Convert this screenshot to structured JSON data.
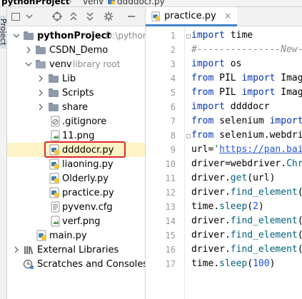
{
  "breadcrumb": {
    "project": "pythonProject",
    "sep": "›",
    "folder": "venv",
    "file": "ddddocr.py"
  },
  "toolwindow": {
    "side_label": "Project"
  },
  "project_header": {
    "buttons": [
      "square-icon",
      "chevron-down-icon",
      "crosshair-icon",
      "collapse-icon",
      "expand-icon",
      "gear-icon",
      "minus-icon"
    ]
  },
  "tree": {
    "root": {
      "label": "pythonProject",
      "hint": "D:\\python"
    },
    "items": [
      {
        "label": "CSDN_Demo",
        "icon": "folder-icon"
      },
      {
        "label": "venv",
        "hint": "library root",
        "icon": "folder-icon"
      },
      {
        "label": "Lib",
        "icon": "folder-icon"
      },
      {
        "label": "Scripts",
        "icon": "folder-icon"
      },
      {
        "label": "share",
        "icon": "folder-icon"
      },
      {
        "label": ".gitignore",
        "icon": "gitignore-icon"
      },
      {
        "label": "11.png",
        "icon": "image-file-icon"
      },
      {
        "label": "ddddocr.py",
        "icon": "python-file-icon"
      },
      {
        "label": "liaoning.py",
        "icon": "python-file-icon"
      },
      {
        "label": "Olderly.py",
        "icon": "python-file-icon"
      },
      {
        "label": "practice.py",
        "icon": "python-file-icon"
      },
      {
        "label": "pyvenv.cfg",
        "icon": "config-file-icon"
      },
      {
        "label": "verf.png",
        "icon": "image-file-icon"
      },
      {
        "label": "main.py",
        "icon": "python-file-icon"
      },
      {
        "label": "External Libraries",
        "icon": "libraries-icon"
      },
      {
        "label": "Scratches and Consoles",
        "icon": "scratches-icon"
      }
    ]
  },
  "editor": {
    "tab": {
      "label": "practice.py",
      "close": "×"
    },
    "line_numbers": [
      "1",
      "2",
      "3",
      "4",
      "5",
      "6",
      "7",
      "8",
      "9",
      "10",
      "11",
      "12",
      "13",
      "14",
      "15",
      "16",
      "17"
    ],
    "lines": [
      {
        "kw": "import",
        "rest": " time"
      },
      {
        "comment": "#---------------New-"
      },
      {
        "kw": "import",
        "rest": " os"
      },
      {
        "kw": "from",
        "rest": " PIL ",
        "kw2": "import",
        "rest2": " Imag"
      },
      {
        "kw": "from",
        "rest": " PIL ",
        "kw2": "import",
        "rest2": " Imag"
      },
      {
        "kw": "import",
        "rest": " ddddocr"
      },
      {
        "kw": "from",
        "rest": " selenium ",
        "kw2": "import"
      },
      {
        "kw": "from",
        "rest": " selenium.webdri"
      },
      {
        "pre": "url=",
        "str_q": "'",
        "url": "https://pan.bai"
      },
      {
        "pre": "driver=webdriver.",
        "fn": "Chr"
      },
      {
        "pre": "driver.",
        "fn": "get",
        "post": "(url)"
      },
      {
        "pre": "driver.",
        "fn": "find_element",
        "post": "("
      },
      {
        "pre": "time.",
        "fn": "sleep",
        "post": "(",
        "num": "2",
        "post2": ")"
      },
      {
        "pre": "driver.",
        "fn": "find_element",
        "post": "("
      },
      {
        "pre": "driver.",
        "fn": "find_element",
        "post": "("
      },
      {
        "pre": "driver.",
        "fn": "find_element",
        "post": "("
      },
      {
        "pre": "time.",
        "fn": "sleep",
        "post": "(",
        "num": "100",
        "post2": ")"
      }
    ]
  },
  "colors": {
    "keyword": "#0033b3",
    "function": "#00627a",
    "selection_highlight": "#fdf3c6",
    "annotation_box": "#e0262b",
    "tab_underline": "#4083c9"
  }
}
